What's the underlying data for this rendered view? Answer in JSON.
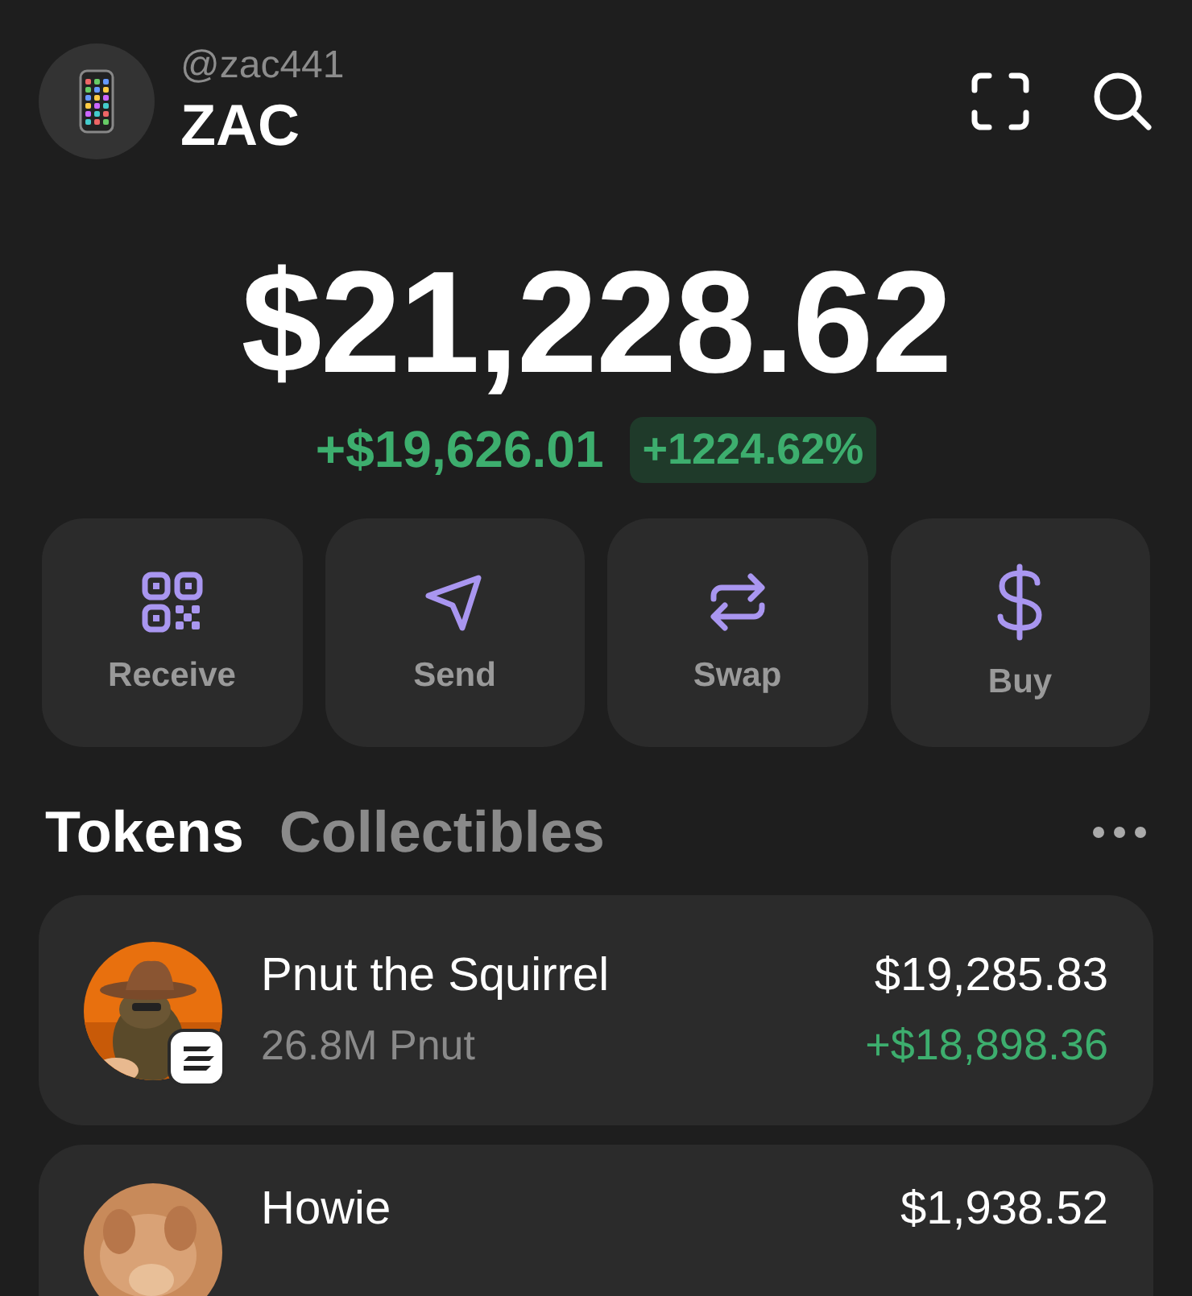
{
  "profile": {
    "handle": "@zac441",
    "name": "ZAC"
  },
  "balance": {
    "total": "$21,228.62",
    "change": "+$19,626.01",
    "change_percent": "+1224.62%"
  },
  "actions": [
    {
      "kind": "receive",
      "label": "Receive"
    },
    {
      "kind": "send",
      "label": "Send"
    },
    {
      "kind": "swap",
      "label": "Swap"
    },
    {
      "kind": "buy",
      "label": "Buy"
    }
  ],
  "tabs": [
    {
      "label": "Tokens",
      "selected": true
    },
    {
      "label": "Collectibles",
      "selected": false
    }
  ],
  "tokens": [
    {
      "name": "Pnut the Squirrel",
      "amount": "26.8M Pnut",
      "value": "$19,285.83",
      "change": "+$18,898.36",
      "chain_badge": true
    },
    {
      "name": "Howie",
      "value": "$1,938.52"
    }
  ]
}
